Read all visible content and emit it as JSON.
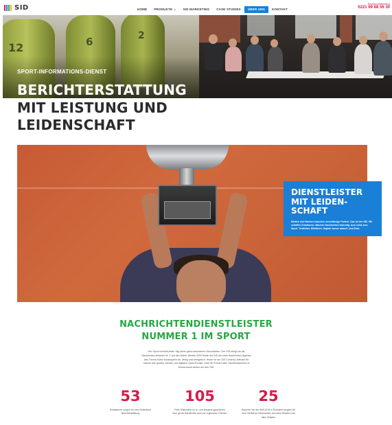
{
  "logo": {
    "text": "SID",
    "bar_colors": [
      "#d81b4a",
      "#1a7fd6",
      "#27a744",
      "#f2b21b"
    ]
  },
  "nav": {
    "items": [
      {
        "label": "HOME",
        "active": false
      },
      {
        "label": "PRODUKTE ⌄",
        "active": false
      },
      {
        "label": "SID MARKETING",
        "active": false
      },
      {
        "label": "CASE STUDIES",
        "active": false
      },
      {
        "label": "ÜBER UNS",
        "active": true
      },
      {
        "label": "KONTAKT",
        "active": false
      }
    ]
  },
  "contact": {
    "small": "Redaktion/Marketing",
    "phone": "0221 99 88 56 30"
  },
  "hero": {
    "kicker": "SPORT-INFORMATIONS-DIENST",
    "title_lines": [
      "BERICHTERSTATTUNG",
      "MIT LEISTUNG UND",
      "LEIDENSCHAFT"
    ],
    "seat_numbers": [
      "12",
      "6",
      "2"
    ]
  },
  "feature": {
    "title_lines": [
      "DIENSTLEISTER",
      "MIT LEIDEN-",
      "SCHAFT"
    ],
    "text": "Medien und Marken brauchen zuverlässige Partner. Das ist der SID. Wir schaffen Emotionen. Machen Nachrichten lebendig. Aus Liebe zum Sport. Textlicher. Bildlicher. Digital. Immer aktuell. Und Echt."
  },
  "section": {
    "title_lines": [
      "NACHRICHTENDIENSTLEISTER",
      "NUMMER 1 IM SPORT"
    ],
    "paragraph": "Der Sport schreibt jeden Tag seine ganz besonderen Geschichten. Der SID bringt sie als Nachrichten-Anbieter Nr. 1 auf den Markt. Bereits 2009 führte der SID als erste Nachrichten-Agentur das Thema Video konsequent ein. Mutig und erfolgreich. Heute ist der SID Content-Lieferant für nahezu alle großen Sender und digitalen Sport-Portale. Über 90 Prozent aller Sportredaktionen in Deutschland setzen auf den SID."
  },
  "stats": [
    {
      "number": "53",
      "text": "Redakteure sorgen für eine lückenlose Berichterstattung"
    },
    {
      "number": "105",
      "text": "Freie Mitarbeiter im In- und Ausland garantieren eine große Bandbreite auch an regionalen Themen"
    },
    {
      "number": "25",
      "text": "Reporter bei der WM 2018 in Russland sorgten für eine Vielfalt an Nachrichten aus allen Stadien und allen Städten"
    }
  ]
}
